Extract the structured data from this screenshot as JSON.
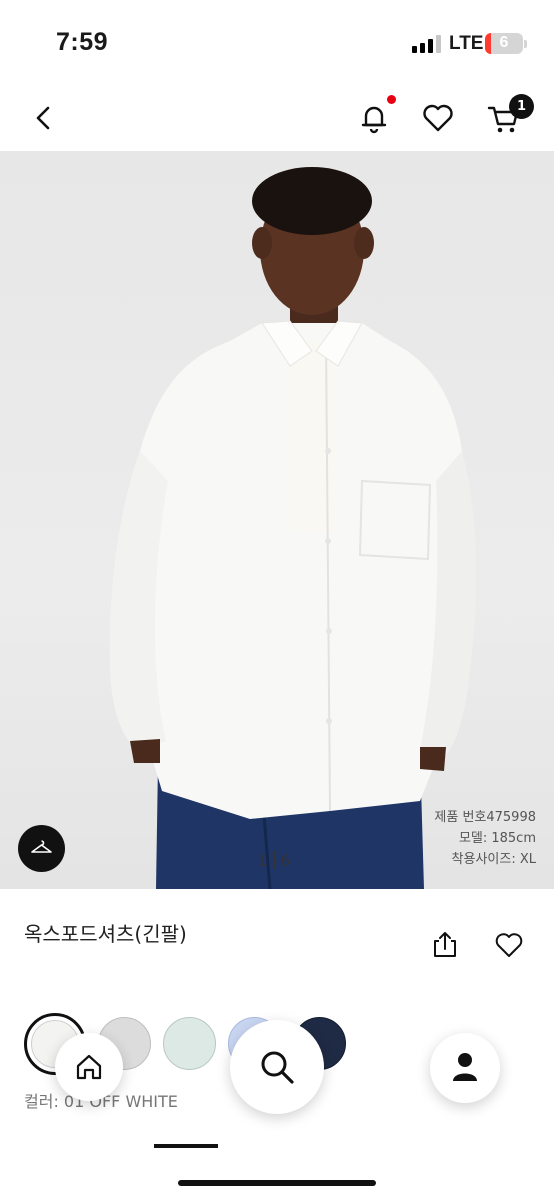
{
  "status_bar": {
    "time": "7:59",
    "network": "LTE",
    "battery": "6",
    "battery_color": "#ff3b30"
  },
  "header": {
    "icons": [
      "back-icon",
      "bell-icon",
      "heart-icon",
      "cart-icon"
    ],
    "notification_dot_color": "#e60012",
    "cart_count": "1"
  },
  "gallery": {
    "current": "1",
    "total": "6",
    "model_info": {
      "product_number": "제품 번호475998",
      "model": "모델: 185cm",
      "size": "착용사이즈: XL"
    }
  },
  "product": {
    "title": "옥스포드셔츠(긴팔)"
  },
  "colors": {
    "label": "컬러: 01 OFF WHITE",
    "swatches": [
      "#f3f3f1",
      "#dcdcdc",
      "#dce9e5",
      "#c9d6f2",
      "#1f2a44"
    ]
  },
  "nav": {
    "icons": [
      "home-icon",
      "search-icon",
      "account-icon"
    ]
  }
}
